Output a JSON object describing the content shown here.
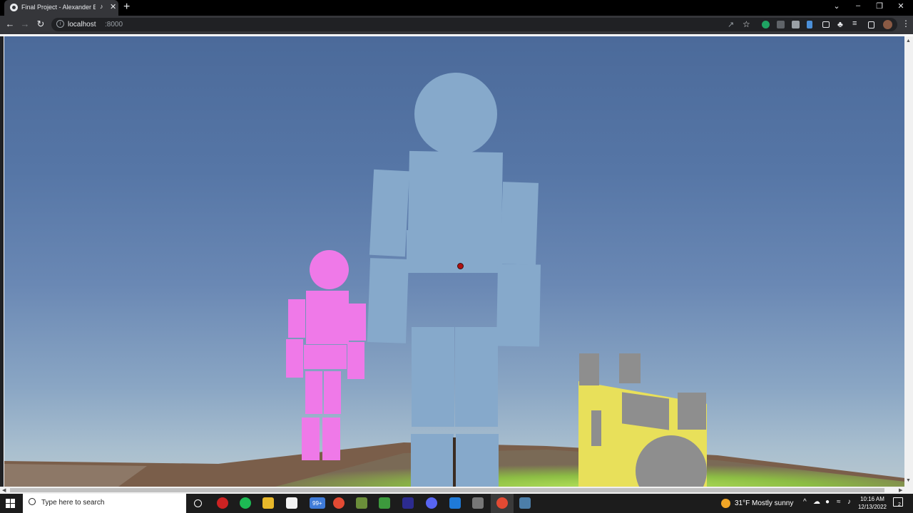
{
  "browser": {
    "tab_title": "Final Project - Alexander Elg",
    "new_tab": "+",
    "url_host": "localhost",
    "url_port": ":8000",
    "accent": "#35363a"
  },
  "scene": {
    "sky_top": "#4b6a9a",
    "sky_bottom": "#b9c7cf",
    "figure_color_large": "#86a9cb",
    "figure_color_small": "#ef79e8",
    "weapon_color": "#e8e05a",
    "crosshair_color": "#b01010"
  },
  "taskbar": {
    "search_placeholder": "Type here to search",
    "mail_badge": "99+",
    "weather": "31°F  Mostly sunny",
    "time": "10:16 AM",
    "date": "12/13/2022",
    "notification_count": "2"
  }
}
